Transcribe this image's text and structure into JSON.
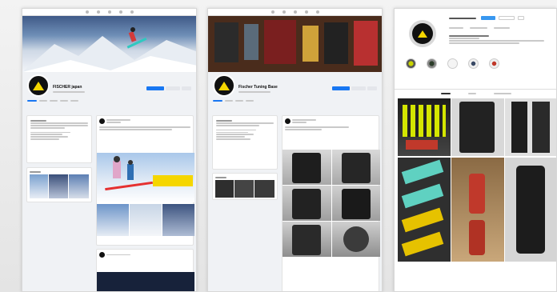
{
  "panel1": {
    "page_name": "FISCHER japan"
  },
  "panel2": {
    "page_name": "Fischer Tuning Base"
  },
  "panel3": {
    "colors": {
      "follow": "#3897f0",
      "accent_yellow": "#f5d600"
    }
  },
  "colors": {
    "facebook_blue": "#1877f2",
    "fischer_black": "#111111",
    "fischer_yellow": "#f5d600"
  }
}
